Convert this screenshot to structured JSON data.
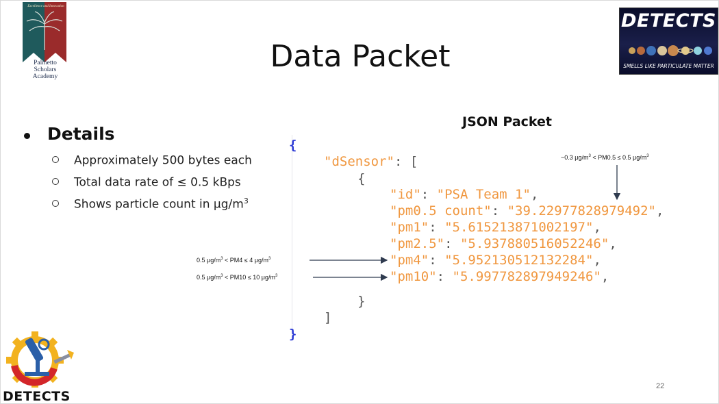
{
  "header": {
    "title": "Data Packet",
    "school_logo": {
      "motto": "Excellence and Innovation",
      "name_lines": [
        "Palmetto",
        "Scholars",
        "Academy"
      ]
    },
    "banner": {
      "title": "DETECTS",
      "subtitle": "SMELLS LIKE PARTICULATE MATTER"
    }
  },
  "details": {
    "heading": "Details",
    "items": [
      {
        "text": "Approximately 500 bytes each",
        "sup": ""
      },
      {
        "text": "Total data rate of ≤ 0.5 kBps",
        "sup": ""
      },
      {
        "text": "Shows particle count in μg/m",
        "sup": "3"
      }
    ]
  },
  "json_packet": {
    "heading": "JSON Packet",
    "open_brace": "{",
    "array_key": "\"dSensor\"",
    "array_open": ": [",
    "inner_open": "{",
    "fields": [
      {
        "key": "\"id\"",
        "value": "\"PSA Team 1\""
      },
      {
        "key": "\"pm0.5 count\"",
        "value": "\"39.22977828979492\""
      },
      {
        "key": "\"pm1\"",
        "value": "\"5.615213871002197\""
      },
      {
        "key": "\"pm2.5\"",
        "value": "\"5.937880516052246\""
      },
      {
        "key": "\"pm4\"",
        "value": "\"5.952130512132284\""
      },
      {
        "key": "\"pm10\"",
        "value": "\"5.997782897949246\""
      }
    ],
    "inner_close": "}",
    "array_close": "]",
    "close_brace": "}"
  },
  "annotations": {
    "pm05": {
      "prefix": "~0.3 μg/m",
      "sup": "3",
      "suffix": " < PM0.5 ≤ 0.5 μg/m",
      "sup2": "3"
    },
    "pm4": {
      "prefix": "0.5 μg/m",
      "sup": "3",
      "suffix": " < PM4 ≤ 4 μg/m",
      "sup2": "3"
    },
    "pm10": {
      "prefix": "0.5 μg/m",
      "sup": "3",
      "suffix": " < PM10 ≤ 10 μg/m",
      "sup2": "3"
    }
  },
  "footer": {
    "logo_text": "DETECTS",
    "page_number": "22"
  },
  "colors": {
    "code_key_value": "#f0973f",
    "code_brace": "#2d3bd6",
    "code_punct": "#555555"
  }
}
